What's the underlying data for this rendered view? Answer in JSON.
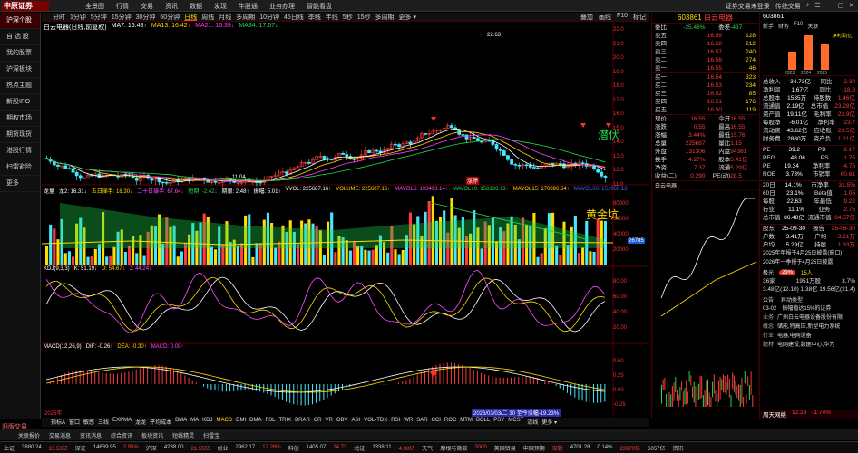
{
  "topbar": {
    "logo": "中原证券",
    "menu": [
      "全景图",
      "行情",
      "交易",
      "资讯",
      "数据",
      "发现",
      "牛股通",
      "业务办理",
      "智能看盘"
    ],
    "right": [
      "证券交易未登录",
      "传统交易",
      "♪",
      "☰",
      "—",
      "▢",
      "✕"
    ]
  },
  "sidebar": [
    "沪深个股",
    "自 选 股",
    "我的股票",
    "沪深板块",
    "热点主题",
    "新股IPO",
    "期权市场",
    "期货现货",
    "港股行情",
    "扫雷避险",
    "更多"
  ],
  "sidebar_bottom": "旧版交易",
  "tabs": [
    "分时",
    "1分钟",
    "5分钟",
    "15分钟",
    "30分钟",
    "60分钟",
    "日线",
    "周线",
    "月线",
    "多周期",
    "10分钟",
    "45日线",
    "季线",
    "年线",
    "5秒",
    "15秒",
    "多周期",
    "更多 ▾"
  ],
  "tabs_right": [
    "叠加",
    "画线",
    "F10",
    "标记",
    "统计",
    "画线",
    "F10",
    "标记"
  ],
  "legend_ma": {
    "name": "白云电器(日线,前复权)",
    "ma7": "MA7: 16.48↑",
    "ma13": "MA13: 16.42↑",
    "ma21": "MA21: 16.39↓",
    "ma34": "MA34: 17.67↓"
  },
  "legend_vol": [
    "龙量",
    "龙2: 16.31↓",
    "五日操手: 18.30↓",
    "二十日操手: 67.64↓",
    "短期: -2.42↓",
    "期限: 2.48↑",
    "振幅: 5.01↑",
    "VVOL: 225687.16↑",
    "VOLUME: 225687.16↑",
    "MAVOL5: 193493.14↑",
    "MAVOL10: 158136.13↑",
    "MAVOL15: 170896.64↑",
    "MAVOL60: 151060.13↑"
  ],
  "legend_kdj": [
    "KDJ(9,3,3)",
    "K: 51.19↓",
    "D: 54.67↓",
    "J: 44.24↓"
  ],
  "legend_macd": [
    "MACD(12,26,9)",
    "DIF: -0.26↑",
    "DEA: -0.30↑",
    "MACD: 0.08↑"
  ],
  "annotations": {
    "high": "22.63",
    "low": "←11.04",
    "qianfu": "潜伏",
    "huangjinkeng": "黄金坑",
    "zhangting": "涨停",
    "date_bar": "2026/03/03/二 30 至今涨幅-19.23%",
    "vol_tag": "26785",
    "left_tag": "2025年"
  },
  "price_axis": [
    "22.0",
    "21.0",
    "20.0",
    "19.0",
    "18.0",
    "17.0",
    "16.0",
    "15.0",
    "14.0",
    "13.0",
    "12.0",
    "11.0"
  ],
  "vol_axis": [
    "80000",
    "60000",
    "40000",
    "20000"
  ],
  "kdj_axis": [
    "80.00",
    "60.00",
    "40.00",
    "20.00"
  ],
  "macd_axis": [
    "0.50",
    "0.25",
    "0.00",
    "-0.25"
  ],
  "ind_tabs": [
    "指标A",
    "窗口",
    "敏感",
    "三线",
    "EXPMA",
    "龙龙",
    "平均成本",
    "BMA",
    "MA",
    "KDJ",
    "MACD",
    "DMI",
    "DMA",
    "FSL",
    "TRIX",
    "BRAR",
    "CR",
    "VR",
    "OBV",
    "ASI",
    "VOL-TDX",
    "RSI",
    "WR",
    "SAR",
    "CCI",
    "ROC",
    "MTM",
    "BOLL",
    "PSY",
    "MCST",
    "流线",
    "更多 ▾"
  ],
  "ind_tabs_right": [
    "指标B",
    "模",
    "板",
    "日线"
  ],
  "quote": {
    "code": "603861",
    "name": "白云电器",
    "wb_label": "委比",
    "wb": "-25.48%",
    "wc_label": "委差",
    "wc": "-437",
    "asks": [
      [
        "卖五",
        "16.59",
        "128"
      ],
      [
        "卖四",
        "16.58",
        "212"
      ],
      [
        "卖三",
        "16.57",
        "240"
      ],
      [
        "卖二",
        "16.56",
        "274"
      ],
      [
        "卖一",
        "16.55",
        "46"
      ]
    ],
    "bids": [
      [
        "买一",
        "16.54",
        "323"
      ],
      [
        "买二",
        "16.53",
        "234"
      ],
      [
        "买三",
        "16.52",
        "85"
      ],
      [
        "买四",
        "16.51",
        "176"
      ],
      [
        "买五",
        "16.50",
        "119"
      ]
    ],
    "stats": [
      [
        "现价",
        "16.55",
        "今开",
        "16.55"
      ],
      [
        "涨跌",
        "0.55",
        "最高",
        "16.55"
      ],
      [
        "涨幅",
        "3.44%",
        "最低",
        "15.76"
      ],
      [
        "总量",
        "225687",
        "量比",
        "1.15"
      ],
      [
        "外盘",
        "131306",
        "内盘",
        "94381"
      ],
      [
        "换手",
        "4.27%",
        "股本",
        "5.41亿"
      ],
      [
        "净资",
        "7.37",
        "流通",
        "5.29亿"
      ],
      [
        "收益(二)",
        "0.290",
        "PE(动)",
        "28.5"
      ]
    ],
    "mini_title": "白云电器"
  },
  "right": {
    "code": "603861",
    "tabs": [
      "新手",
      "财务",
      "F10",
      "关联"
    ],
    "chart_years": [
      "2023",
      "2024",
      "2025"
    ],
    "chart_label": "净利润(亿)",
    "rows": [
      [
        "总收入",
        "34.73亿",
        "同比",
        "-2.30"
      ],
      [
        "净利润",
        "1.67亿",
        "同比",
        "-18.8"
      ],
      [
        "总股本",
        "1535万",
        "持股数",
        "1.46亿"
      ],
      [
        "流通值",
        "2.19亿",
        "总市值",
        "23.28亿"
      ],
      [
        "资产值",
        "19.11亿",
        "毛利率",
        "23.9亿"
      ],
      [
        "每股净",
        "-6.01亿",
        "净利率",
        "23.7"
      ],
      [
        "流动资",
        "43.62亿",
        "应收账",
        "23.5亿"
      ],
      [
        "财务费",
        "2880万",
        "资产负",
        "1.21亿"
      ]
    ],
    "rows2": [
      [
        "PE",
        "39.2",
        "PB",
        "2.17"
      ],
      [
        "PEG",
        "48.06",
        "PS",
        "1.75"
      ],
      [
        "PE",
        "19.34",
        "净利率",
        "4.75"
      ],
      [
        "ROE",
        "3.73%",
        "市销率",
        "60.61"
      ]
    ],
    "rows3": [
      [
        "20日",
        "14.1%",
        "市净率",
        "31.5%"
      ],
      [
        "60日",
        "23.1%",
        "Beta值",
        "1.05"
      ],
      [
        "每股",
        "22.63",
        "年最低",
        "9.22"
      ],
      [
        "行业",
        "11.1%",
        "业务",
        "2.75"
      ],
      [
        "总市值",
        "86.48亿",
        "流通市值",
        "84.57亿"
      ]
    ],
    "dates": [
      [
        "股东",
        "25-09-30",
        "报告",
        "25-06-30"
      ],
      [
        "户数",
        "3.41万",
        "户均",
        "3.21万"
      ],
      [
        "户均",
        "5.29亿",
        "持股",
        "1.33万"
      ]
    ],
    "notes": [
      "2025年年报于4月25日披露(窗口)",
      "2026年一季报于4月25日披露"
    ],
    "jh_label": "极光",
    "jh_val": "29%",
    "level": "15人",
    "mix": [
      "36家",
      "1951万股",
      "3.7%"
    ],
    "fin": [
      "3.48亿(12.10)",
      "1.38亿",
      "19.56亿(21.4)"
    ],
    "tabs2": [
      "公告",
      "异动类型"
    ],
    "anno_date": "03-02",
    "anno_text": "振幅值达15%的证券",
    "biz": [
      "业务",
      "广州白云电器设备股份有限",
      "概念",
      "储能,特高压,新型电力系统",
      "行业",
      "电器,电网设备",
      "题材",
      "电网建设,数据中心,华为"
    ],
    "foot": [
      "周天网络",
      "12.29",
      "-1.74%"
    ]
  },
  "status": [
    "上海",
    "2.18",
    "2900",
    "1.94%",
    "深证",
    "6.31",
    "6.15%",
    "创业",
    "4.38",
    "1.21%",
    "科创",
    "5.58",
    "沪深",
    "6.21",
    "1.19%"
  ],
  "bottom1": [
    "关联报价",
    "交易消息",
    "资讯消息",
    "综合资讯",
    "板块资讯",
    "短线精灵",
    "扫雷宝"
  ],
  "bottom2": [
    "上证",
    "3880.24",
    "13.53亿",
    "深证",
    "14639.95",
    "2.95%",
    "沪深",
    "4238.00",
    "21.55亿",
    "创业",
    "2962.17",
    "12.28%",
    "科创",
    "1405.07",
    "14.73",
    "北证",
    "1338.11",
    "4.98亿",
    "天气",
    "摩根与微软",
    "3000",
    "英国贸易",
    "中国预期",
    "深股",
    "4701.28",
    "0.14%",
    "23970亿",
    "6057亿",
    "资讯"
  ]
}
